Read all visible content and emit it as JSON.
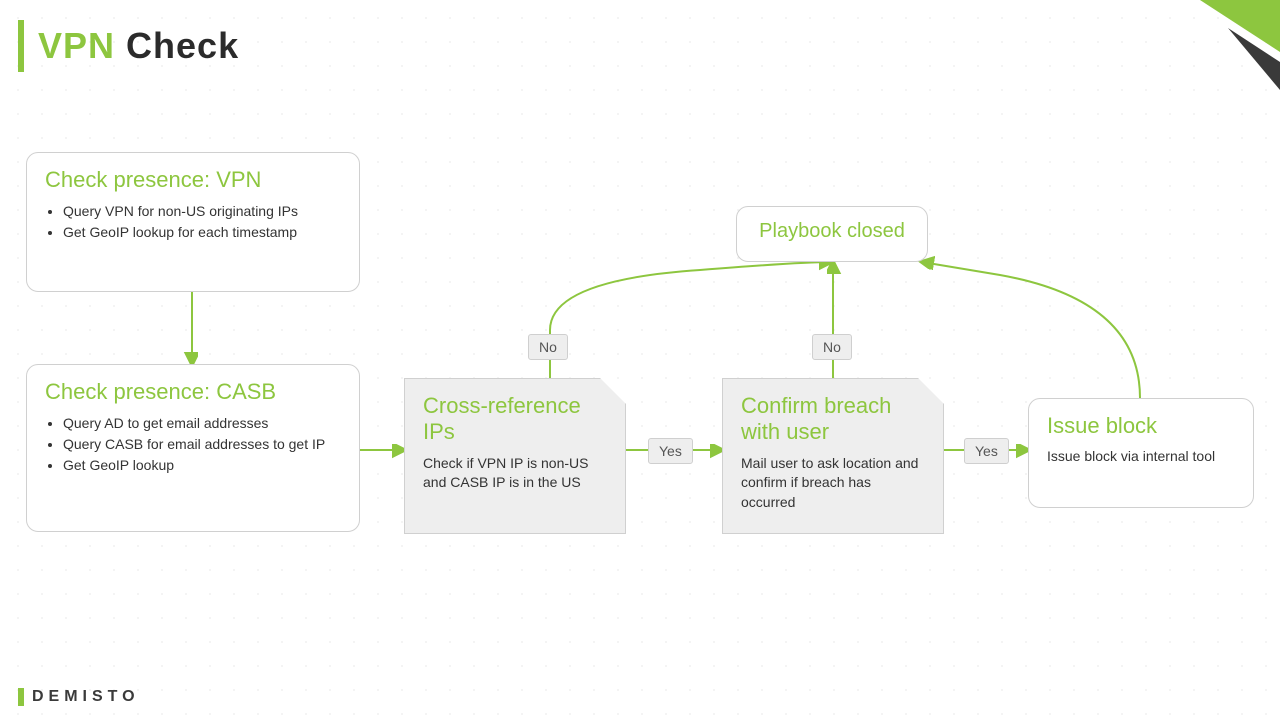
{
  "title": {
    "part1": "VPN",
    "part2": " Check"
  },
  "footer": "DEMISTO",
  "nodes": {
    "vpn": {
      "title": "Check presence: VPN",
      "items": [
        "Query VPN for non-US originating IPs",
        "Get GeoIP lookup for each timestamp"
      ]
    },
    "casb": {
      "title": "Check presence: CASB",
      "items": [
        "Query AD to get email addresses",
        "Query CASB for email addresses to get IP",
        "Get GeoIP lookup"
      ]
    },
    "crossref": {
      "title": "Cross-reference IPs",
      "desc": "Check if VPN IP is non-US and CASB IP is in the US"
    },
    "confirm": {
      "title": "Confirm breach with user",
      "desc": "Mail user to ask location and confirm if breach has occurred"
    },
    "issue": {
      "title": "Issue block",
      "desc": "Issue block via internal tool"
    },
    "closed": {
      "title": "Playbook closed"
    }
  },
  "labels": {
    "yes": "Yes",
    "no": "No"
  }
}
